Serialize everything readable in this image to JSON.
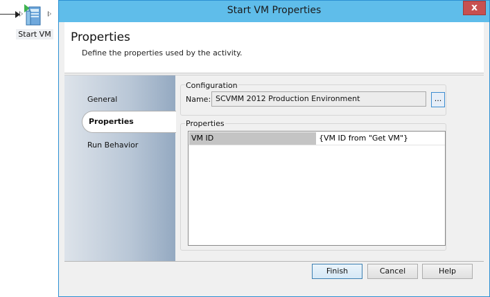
{
  "canvas": {
    "activity_label": "Start VM",
    "activity_icon": "vm-start-icon"
  },
  "dialog": {
    "title": "Start VM Properties",
    "close_label": "x",
    "header": {
      "title": "Properties",
      "subtitle": "Define the properties used by the activity."
    },
    "nav": [
      {
        "label": "General"
      },
      {
        "label": "Properties"
      },
      {
        "label": "Run Behavior"
      }
    ],
    "selected_nav": "Properties",
    "configuration": {
      "group_label": "Configuration",
      "name_label": "Name:",
      "name_value": "SCVMM 2012 Production Environment",
      "browse_label": "..."
    },
    "properties": {
      "group_label": "Properties",
      "rows": [
        {
          "key": "VM ID",
          "value": "{VM ID from \"Get VM\"}"
        }
      ]
    },
    "buttons": {
      "finish": "Finish",
      "cancel": "Cancel",
      "help": "Help"
    }
  },
  "colors": {
    "titlebar": "#5fbdea",
    "close_button": "#c75050",
    "nav_gradient_end": "#94a9c1"
  }
}
